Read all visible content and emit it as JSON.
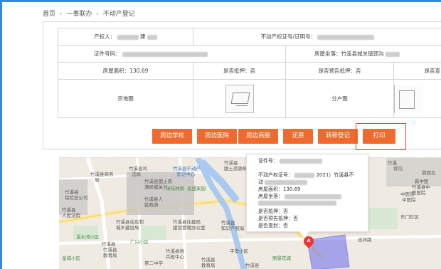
{
  "breadcrumb": {
    "home": "首页",
    "sep1": "›",
    "section": "一事联办",
    "sep2": "›",
    "current": "不动产登记"
  },
  "record": {
    "owner_label": "产权人：",
    "owner_value_suffix": "建",
    "cert_no_label": "不动产权证号/证明号：",
    "cert_label": "证件号码：",
    "location_label": "房屋坐落：竹溪县城关镇郭沟",
    "area_label": "房屋面积：130.69",
    "mortgaged_label": "是否抵押：否",
    "pre_mortgaged_label": "是否预告抵押：否",
    "sealed_label": "是否查",
    "lot_plan_label": "宗地图",
    "unit_plan_label": "分户图"
  },
  "actions": [
    {
      "label": "周边学校"
    },
    {
      "label": "周边医院"
    },
    {
      "label": "周边商圈"
    },
    {
      "label": "还原"
    },
    {
      "label": "转移登记"
    },
    {
      "label": "打印"
    }
  ],
  "popup": {
    "l1": "证件号：",
    "l2a": "不动产权证号：",
    "l2b": "2021）竹溪县不",
    "l3": "动",
    "l4": "房屋面积：130.69",
    "l5": "房屋坐落：",
    "l6": "是否抵押：否",
    "l7": "是否预告抵押：否",
    "l8": "是否查封：否"
  },
  "map": {
    "labels": [
      "竹溪县商务",
      "局",
      "竹溪县司",
      "法局",
      "竹溪县不动产",
      "登记中心",
      "竹溪县",
      "保险总公司",
      "竹溪县国土资",
      "源局城关分",
      "竹溪",
      "郭沟",
      "中医院",
      "中医院",
      "竹溪县",
      "人民法院",
      "竹溪县人",
      "民政府",
      "竹溪县住房和",
      "城乡建设局",
      "竹溪县住建局",
      "建设管理办公室",
      "竹溪县",
      "知识产权局",
      "竹溪县",
      "国土资源局",
      "昌盛家园",
      "溪水湾小区",
      "广兴小区",
      "皇城小区",
      "平安小区",
      "新中医",
      "竹溪县中",
      "医医院",
      "竹溪县",
      "竹溪县地",
      "兵役中心",
      "竹溪县",
      "教育局",
      "绿苑林荫",
      "东门社区",
      "鄂西北",
      "竹溪县",
      "教育局",
      "丽景花城",
      "吉祥路",
      "竹溪县",
      "第二中学"
    ],
    "marker": "A"
  },
  "colors": {
    "accent_orange": "#ef6a2e",
    "highlight_red": "#e8433b",
    "nav_blue": "#2f8be0"
  }
}
